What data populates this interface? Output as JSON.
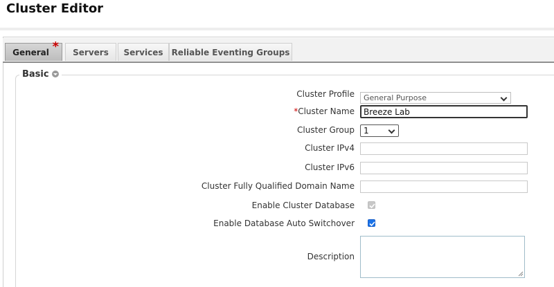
{
  "header": {
    "title": "Cluster Editor"
  },
  "tabs": [
    {
      "label": "General",
      "active": true,
      "modified": true
    },
    {
      "label": "Servers"
    },
    {
      "label": "Services"
    },
    {
      "label": "Reliable Eventing Groups"
    }
  ],
  "section": {
    "legend": "Basic"
  },
  "form": {
    "profile": {
      "label": "Cluster Profile",
      "value": "General Purpose"
    },
    "name": {
      "required_marker": "*",
      "label": "Cluster Name",
      "value": "Breeze Lab"
    },
    "group": {
      "label": "Cluster Group",
      "value": "1"
    },
    "ipv4": {
      "label": "Cluster IPv4",
      "value": ""
    },
    "ipv6": {
      "label": "Cluster IPv6",
      "value": ""
    },
    "fqdn": {
      "label": "Cluster Fully Qualified Domain Name",
      "value": ""
    },
    "enable_db": {
      "label": "Enable Cluster Database",
      "checked": true,
      "disabled": true
    },
    "auto_switchover": {
      "label": "Enable Database Auto Switchover",
      "checked": true
    },
    "description": {
      "label": "Description",
      "value": ""
    }
  },
  "colors": {
    "required": "#cc0000",
    "checkbox": "#1a73e8"
  }
}
